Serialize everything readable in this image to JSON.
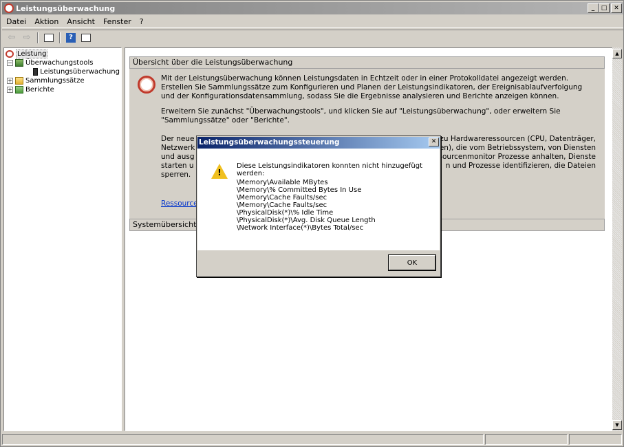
{
  "window": {
    "title": "Leistungsüberwachung"
  },
  "menu": [
    "Datei",
    "Aktion",
    "Ansicht",
    "Fenster",
    "?"
  ],
  "tree": {
    "root": "Leistung",
    "items": [
      {
        "label": "Überwachungstools",
        "expander": "⊟"
      },
      {
        "label": "Leistungsüberwachung"
      },
      {
        "label": "Sammlungssätze",
        "expander": "⊞"
      },
      {
        "label": "Berichte",
        "expander": "⊞"
      }
    ]
  },
  "overview": {
    "header": "Übersicht über die Leistungsüberwachung",
    "p1": "Mit der Leistungsüberwachung können Leistungsdaten in Echtzeit oder in einer Protokolldatei angezeigt werden. Erstellen Sie Sammlungssätze zum Konfigurieren und Planen der Leistungsindikatoren, der Ereignisablaufverfolgung und der Konfigurationsdatensammlung, sodass Sie die Ergebnisse analysieren und Berichte anzeigen können.",
    "p2": "Erweitern Sie zunächst \"Überwachungstools\", und klicken Sie auf \"Leistungsüberwachung\", oder erweitern Sie \"Sammlungssätze\" oder \"Berichte\".",
    "p3_line1": "Der neue",
    "p3_line1_right": "en zu Hardwareressourcen (CPU, Datenträger,",
    "p3_line2": "Netzwerk",
    "p3_line2_right": "odulen), die vom Betriebssystem, von Diensten",
    "p3_line3": "und ausg",
    "p3_line3_right": "ssourcenmonitor Prozesse anhalten, Dienste",
    "p3_line4": "starten u",
    "p3_line4_right": "n und Prozesse identifizieren, die Dateien",
    "p3_line5": "sperren.",
    "link": "Ressource"
  },
  "system": {
    "header": "Systemübersicht"
  },
  "dialog": {
    "title": "Leistungsüberwachungssteuerung",
    "message": "Diese Leistungsindikatoren konnten nicht hinzugefügt werden:",
    "counters": [
      "\\Memory\\Available MBytes",
      "\\Memory\\% Committed Bytes In Use",
      "\\Memory\\Cache Faults/sec",
      "\\Memory\\Cache Faults/sec",
      "\\PhysicalDisk(*)\\% Idle Time",
      "\\PhysicalDisk(*)\\Avg. Disk Queue Length",
      "\\Network Interface(*)\\Bytes Total/sec"
    ],
    "ok": "OK"
  }
}
